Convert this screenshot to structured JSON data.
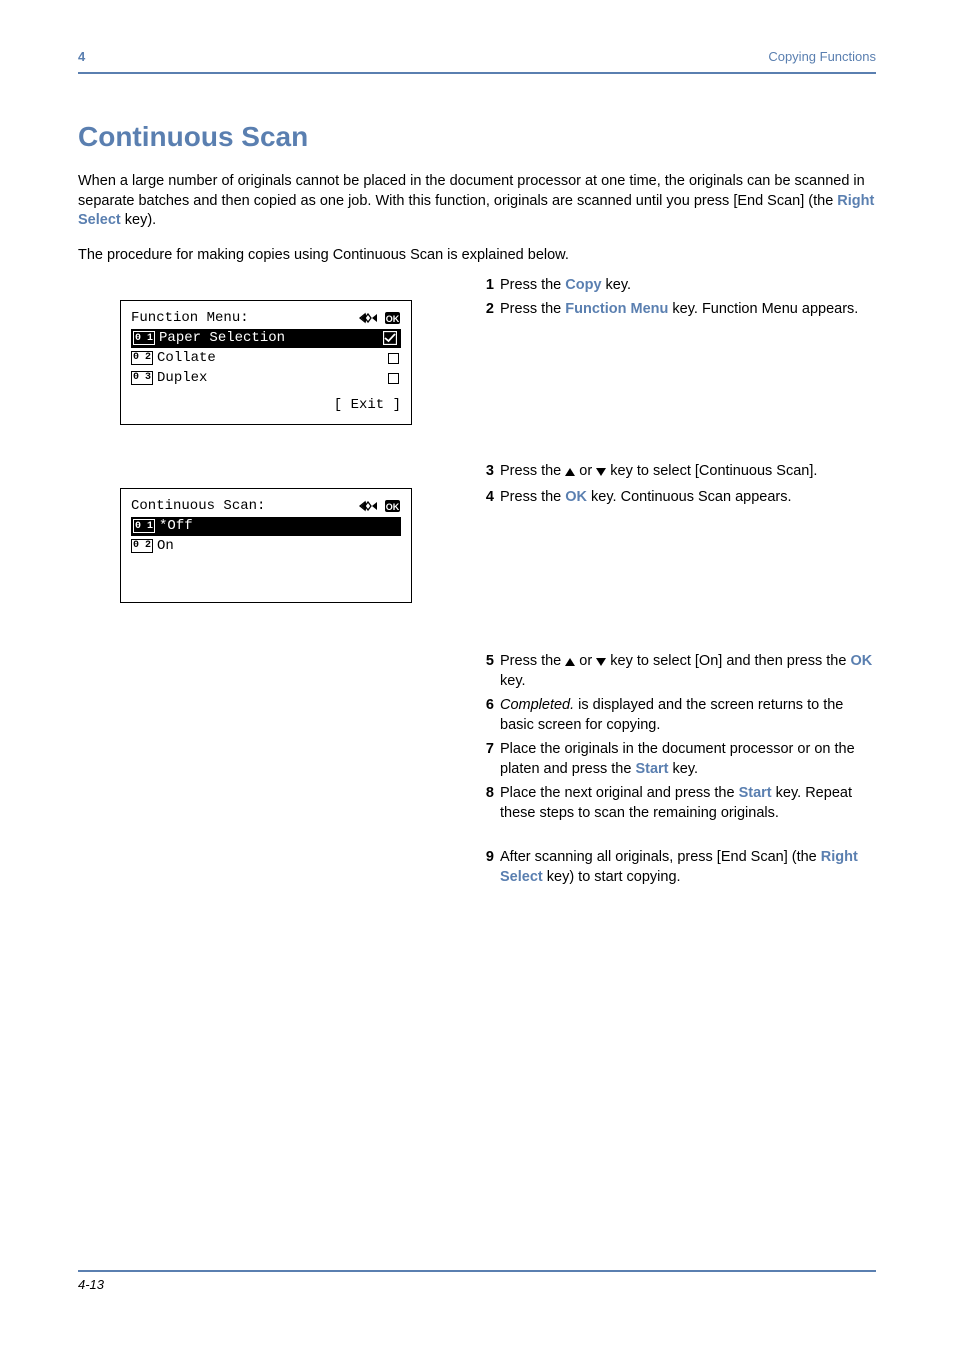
{
  "page": {
    "header_right": "Copying Functions",
    "header_left": "4",
    "footer": "4-13"
  },
  "title": "Continuous Scan",
  "intro": {
    "p1a": "When a large number of originals cannot be placed in the document processor at one time, the originals can be scanned in separate batches and then copied as one job. With this function, originals are scanned until you press [End Scan] (the ",
    "p1b": "Right Select",
    "p1c": " key).",
    "p2": "The procedure for making copies using Continuous Scan is explained below."
  },
  "lcd1": {
    "title": "Function Menu:",
    "r1": {
      "num": "0 1",
      "label": "Paper Selection",
      "icon": "check"
    },
    "r2": {
      "num": "0 2",
      "label": "Collate",
      "icon": "square"
    },
    "r3": {
      "num": "0 3",
      "label": "Duplex",
      "icon": "square"
    },
    "footer": "[ Exit ]"
  },
  "lcd2": {
    "title": "Continuous Scan:",
    "r1": {
      "num": "0 1",
      "label": "*Off"
    },
    "r2": {
      "num": "0 2",
      "label": " On"
    }
  },
  "steps": {
    "n1": "1",
    "s1a": "Press the ",
    "s1b": "Copy",
    "s1c": " key.",
    "n2": "2",
    "s2a": "Press the ",
    "s2b": "Function Menu",
    "s2c": " key. Function Menu appears.",
    "n3": "3",
    "s3": "Press the △ or ▽ key to select [Continuous Scan].",
    "n4": "4",
    "s4a": "Press the ",
    "s4b": "OK",
    "s4c": " key. Continuous Scan appears.",
    "n5": "5",
    "s5a": "Press the △ or ▽ key to select [On] and then press the ",
    "s5b": "OK",
    "s5c": " key.",
    "n6": "6",
    "s6a": "Completed.",
    "s6b": " is displayed and the screen returns to the basic screen for copying.",
    "n7": "7",
    "s7a": "Place the originals in the document processor or on the platen and press the ",
    "s7b": "Start",
    "s7c": " key.",
    "n8": "8",
    "s8a": "Place the next original and press the ",
    "s8b": "Start",
    "s8c": " key. Repeat these steps to scan the remaining originals.",
    "n9": "9",
    "s9a": "After scanning all originals, press [End Scan] (the ",
    "s9b": "Right Select",
    "s9c": " key) to start copying."
  }
}
